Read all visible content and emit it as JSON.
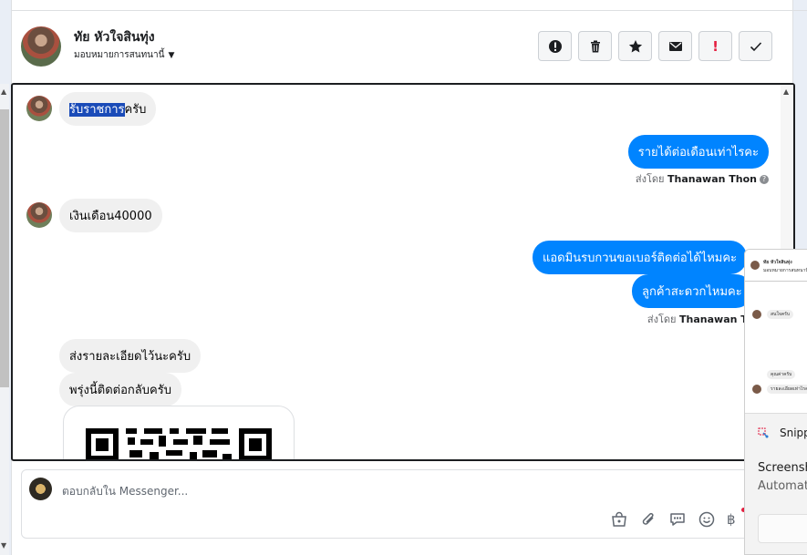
{
  "header": {
    "name": "ทัย หัวใจสินทุ่ง",
    "subtitle": "มอบหมายการสนทนานี้",
    "actions": [
      "info-icon",
      "trash-icon",
      "star-icon",
      "envelope-icon",
      "exclamation-icon",
      "check-icon"
    ],
    "exclamation_mark": "!"
  },
  "messages": {
    "m1_selected": "รับราชการ",
    "m1_rest": "ครับ",
    "m2": "รายได้ต่อเดือนเท่าไรคะ",
    "sent_by_prefix": "ส่งโดย",
    "sent_by_name": "Thanawan Thon",
    "help_mark": "?",
    "m3": "เงินเดือน40000",
    "m4": "แอดมินรบกวนขอเบอร์ติดต่อได้ไหมคะ",
    "m5": "ลูกค้าสะดวกไหมคะ",
    "m6": "ส่งรายละเอียดไว้นะครับ",
    "m7": "พรุ่งนี้ติดต่อกลับครับ"
  },
  "composer": {
    "placeholder": "ตอบกลับใน Messenger...",
    "tools": [
      "bag-icon",
      "paperclip-icon",
      "chat-bubble-icon",
      "smiley-icon",
      "baht-icon"
    ],
    "baht": "฿"
  },
  "snipping": {
    "app_name": "Snipp",
    "title": "Screensh",
    "desc": "Automat",
    "thumb": {
      "name": "ทัย หัวใจสินทุ่ง",
      "sub": "มอบหมายการสนทนานี้",
      "msg1": "สนใจครับ",
      "msg2": "คุณค่าครับ",
      "msg3": "รายละเอียดเท่าไรคะ"
    }
  },
  "colors": {
    "accent": "#0084ff",
    "selection": "#1a4bb8",
    "danger": "#e41e3f"
  }
}
